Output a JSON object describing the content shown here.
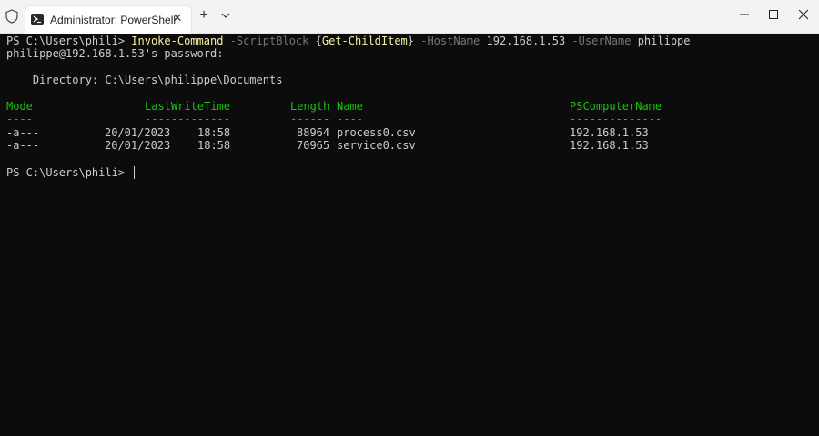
{
  "titlebar": {
    "tab_title": "Administrator: PowerShell",
    "close_glyph": "✕",
    "new_tab_glyph": "+",
    "icons": [
      "shield-icon",
      "powershell-icon",
      "close-icon",
      "plus-icon",
      "chevron-down-icon",
      "minimize-icon",
      "maximize-icon",
      "close-window-icon"
    ]
  },
  "terminal": {
    "prompt1": "PS C:\\Users\\phili> ",
    "cmdlet": "Invoke-Command",
    "param_scriptblock": "-ScriptBlock",
    "brace_open": "{",
    "inner_cmdlet": "Get-ChildItem",
    "brace_close": "}",
    "param_hostname": "-HostName",
    "hostname_value": "192.168.1.53",
    "param_username": "-UserName",
    "username_value": "philippe",
    "password_prompt": "philippe@192.168.1.53's password:",
    "directory_line": "    Directory: C:\\Users\\philippe\\Documents",
    "headers": {
      "mode": "Mode",
      "lastwrite": "LastWriteTime",
      "length": "Length",
      "name": "Name",
      "pscomputer": "PSComputerName"
    },
    "underlines": {
      "mode": "----",
      "lastwrite": "-------------",
      "length": "------",
      "name": "----",
      "pscomputer": "--------------"
    },
    "rows": [
      {
        "mode": "-a---",
        "date": "20/01/2023",
        "time": "18:58",
        "length": "88964",
        "name": "process0.csv",
        "computer": "192.168.1.53"
      },
      {
        "mode": "-a---",
        "date": "20/01/2023",
        "time": "18:58",
        "length": "70965",
        "name": "service0.csv",
        "computer": "192.168.1.53"
      }
    ],
    "prompt2": "PS C:\\Users\\phili> "
  },
  "colors": {
    "background": "#0c0c0c",
    "foreground": "#cccccc",
    "cmdlet": "#f9f1a5",
    "parameter": "#767676",
    "header_green": "#16c60c"
  }
}
